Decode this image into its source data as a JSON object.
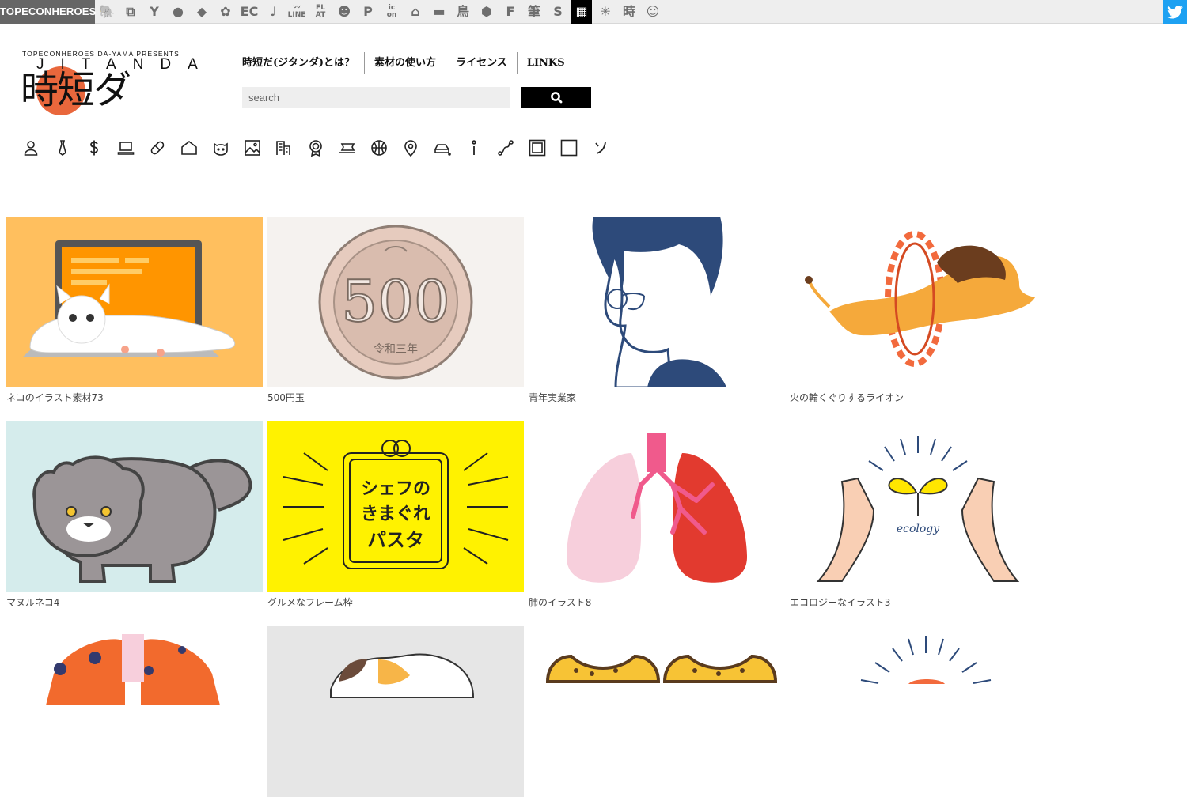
{
  "topbar": {
    "brand": "TOPECONHEROES",
    "icons": [
      {
        "name": "elephant-icon",
        "glyph": "🐘"
      },
      {
        "name": "copy-icon",
        "glyph": "⧉"
      },
      {
        "name": "person-icon",
        "glyph": "Y"
      },
      {
        "name": "speech-bubble-icon",
        "glyph": "●"
      },
      {
        "name": "bird-icon",
        "glyph": "◆"
      },
      {
        "name": "flower-icon",
        "glyph": "✿"
      },
      {
        "name": "ec-icon",
        "glyph": "EC"
      },
      {
        "name": "music-note-icon",
        "glyph": "♩"
      },
      {
        "name": "line-icon",
        "glyph": "〰\nLINE"
      },
      {
        "name": "flat-icon",
        "glyph": "FL\nAT"
      },
      {
        "name": "smile-icon",
        "glyph": "☻"
      },
      {
        "name": "parking-icon",
        "glyph": "P"
      },
      {
        "name": "icon-text-icon",
        "glyph": "ic\non"
      },
      {
        "name": "building-icon",
        "glyph": "⌂"
      },
      {
        "name": "truck-icon",
        "glyph": "▬"
      },
      {
        "name": "bird-kanji-icon",
        "glyph": "鳥"
      },
      {
        "name": "hexagon-icon",
        "glyph": "⬢"
      },
      {
        "name": "f-icon",
        "glyph": "F"
      },
      {
        "name": "brush-kanji-icon",
        "glyph": "筆"
      },
      {
        "name": "s-icon",
        "glyph": "S"
      },
      {
        "name": "grid-icon",
        "glyph": "▦"
      },
      {
        "name": "burst-icon",
        "glyph": "✳"
      },
      {
        "name": "time-kanji-icon",
        "glyph": "時"
      },
      {
        "name": "face-icon",
        "glyph": "☺"
      }
    ]
  },
  "logo": {
    "presents": "TOPECONHEROES DA-YAMA PRESENTS",
    "latin": "JITANDA",
    "japanese": "時短ダ"
  },
  "nav": [
    "時短だ(ジタンダ)とは？",
    "素材の使い方",
    "ライセンス",
    "LINKS"
  ],
  "search": {
    "placeholder": "search"
  },
  "categories": [
    "person-icon",
    "tie-icon",
    "dollar-icon",
    "laptop-icon",
    "pill-icon",
    "house-icon",
    "cat-icon",
    "image-icon",
    "building-icon",
    "award-icon",
    "ticket-icon",
    "basketball-icon",
    "map-pin-icon",
    "car-icon",
    "info-icon",
    "route-icon",
    "frame-icon",
    "square-icon",
    "katakana-so-icon"
  ],
  "gallery": [
    {
      "caption": "ネコのイラスト素材73",
      "bg": "#ffbf5e"
    },
    {
      "caption": "500円玉",
      "bg": "#f5f2ef"
    },
    {
      "caption": "青年実業家",
      "bg": "#ffffff"
    },
    {
      "caption": "火の輪くぐりするライオン",
      "bg": "#ffffff"
    },
    {
      "caption": "マヌルネコ4",
      "bg": "#d5ecec"
    },
    {
      "caption": "グルメなフレーム枠",
      "bg": "#fff200"
    },
    {
      "caption": "肺のイラスト8",
      "bg": "#ffffff"
    },
    {
      "caption": "エコロジーなイラスト3",
      "bg": "#ffffff"
    },
    {
      "caption": "",
      "bg": "#ffffff"
    },
    {
      "caption": "",
      "bg": "#e6e6e6"
    },
    {
      "caption": "",
      "bg": "#ffffff"
    },
    {
      "caption": "",
      "bg": "#ffffff"
    }
  ],
  "illustration_text": {
    "coin_value": "500",
    "coin_era": "令和三年",
    "menu_line1": "シェフの",
    "menu_line2": "きまぐれ",
    "menu_line3": "パスタ",
    "ecology": "ecology"
  }
}
